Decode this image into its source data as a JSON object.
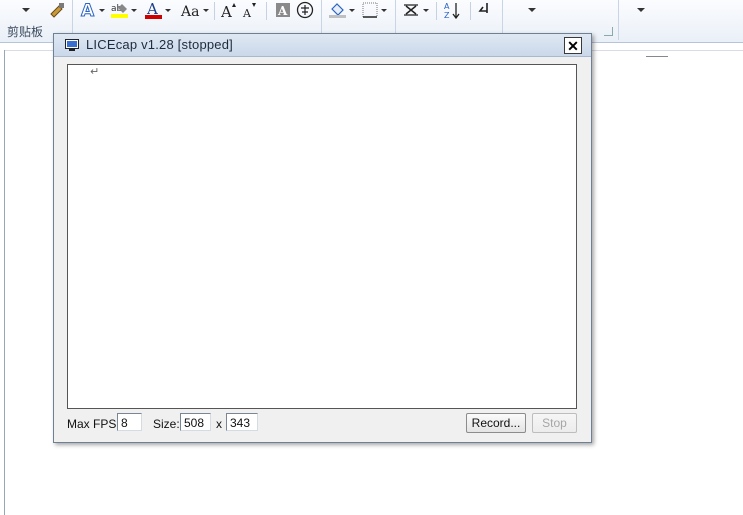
{
  "ribbon": {
    "clipboard_label": "剪贴板",
    "sort_label": "A↓Z"
  },
  "window": {
    "title": "LICEcap v1.28 [stopped]",
    "close_label": "✕"
  },
  "capture": {
    "return_mark": "↵"
  },
  "controls": {
    "max_fps_label": "Max FPS:",
    "max_fps_value": "8",
    "size_label": "Size:",
    "width_value": "508",
    "x_label": "x",
    "height_value": "343",
    "record_label": "Record...",
    "stop_label": "Stop"
  },
  "colors": {
    "highlight": "#ffff00",
    "font_color": "#d00000",
    "accent": "#2a64c5"
  }
}
